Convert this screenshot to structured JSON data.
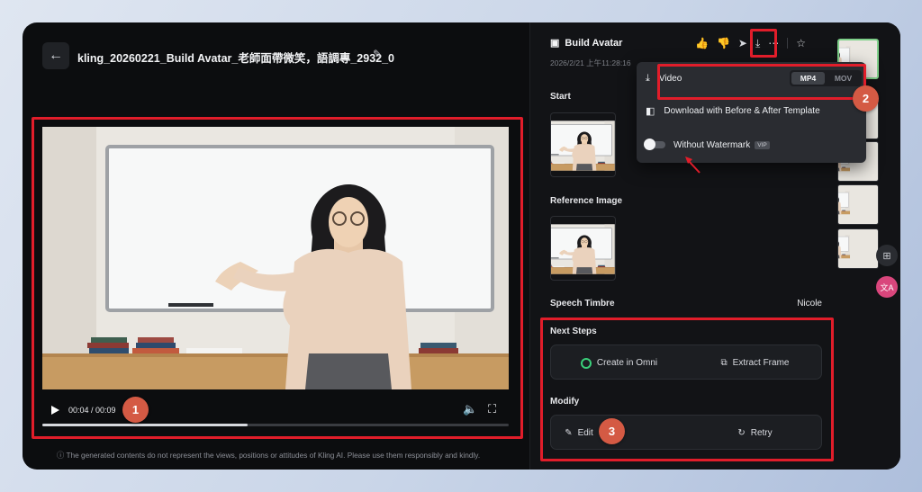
{
  "header": {
    "title": "kling_20260221_Build Avatar_老師面帶微笑，語調專_2932_0"
  },
  "player": {
    "time": "00:04 / 00:09",
    "progress": 0.44
  },
  "disclaimer": "ⓘ The generated contents do not represent the views, positions or attitudes of Kling AI. Please use them responsibly and kindly.",
  "panel": {
    "title": "Build Avatar",
    "date": "2026/2/21 上午11:28:16",
    "start_label": "Start",
    "reference_label": "Reference Image",
    "speech_label": "Speech Timbre",
    "speech_value": "Nicole",
    "next_steps_label": "Next Steps",
    "create_omni": "Create in Omni",
    "extract_frame": "Extract Frame",
    "modify_label": "Modify",
    "edit": "Edit",
    "retry": "Retry"
  },
  "download_menu": {
    "video": "Video",
    "formats": [
      "MP4",
      "MOV"
    ],
    "selected_format": "MP4",
    "template": "Download with Before & After Template",
    "watermark": "Without Watermark",
    "vip": "VIP"
  },
  "badges": [
    "1",
    "2",
    "3"
  ],
  "colors": {
    "highlight": "#e11d2a",
    "badge": "#d45a44"
  }
}
